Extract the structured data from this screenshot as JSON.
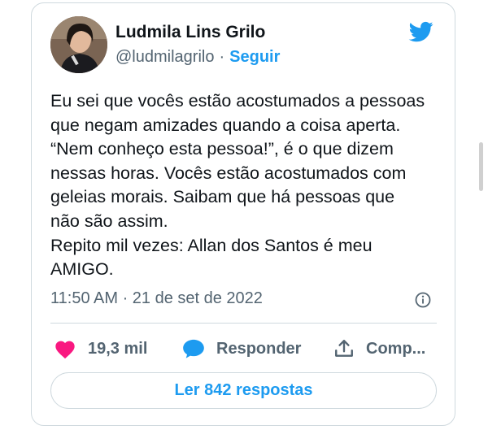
{
  "author": {
    "name": "Ludmila Lins Grilo",
    "handle": "@ludmilagrilo",
    "separator": "·",
    "follow_label": "Seguir"
  },
  "tweet": {
    "lines": [
      "Eu sei que vocês estão acostumados a pessoas",
      "que negam amizades quando a coisa aperta.",
      "“Nem conheço esta pessoa!”, é o que dizem",
      "nessas horas. Vocês estão acostumados com",
      "geleias morais. Saibam que há pessoas que",
      "não são assim.",
      "Repito mil vezes: Allan dos Santos é meu",
      "AMIGO."
    ],
    "timestamp": "11:50 AM · 21 de set de 2022"
  },
  "actions": {
    "likes": "19,3 mil",
    "reply_label": "Responder",
    "share_label": "Comp..."
  },
  "replies_button": "Ler 842 respostas",
  "colors": {
    "brand": "#1d9bf0",
    "like": "#f91880",
    "muted": "#536471",
    "text": "#0f1419",
    "border": "#cfd9de"
  },
  "icons": {
    "logo": "twitter-bird-icon",
    "info": "info-icon",
    "like": "heart-icon",
    "reply": "speech-bubble-icon",
    "share": "share-upload-icon"
  }
}
